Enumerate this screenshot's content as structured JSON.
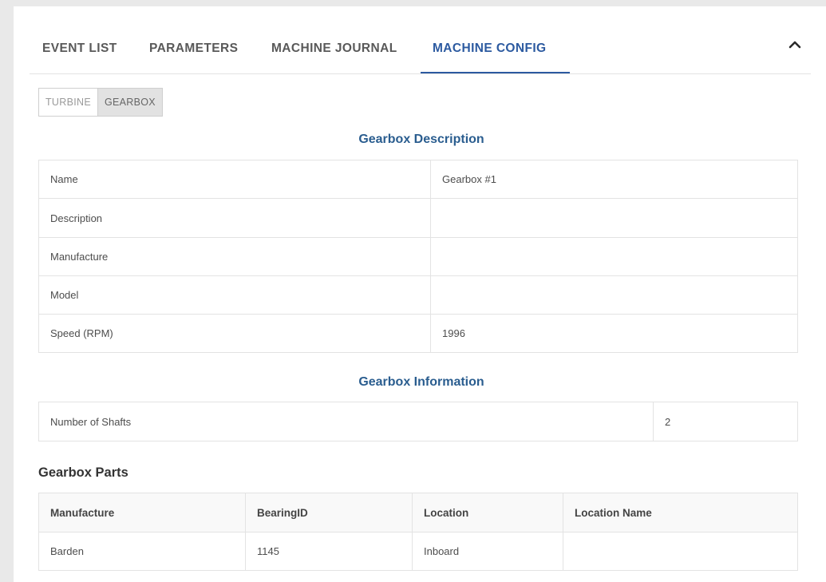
{
  "tabs": [
    {
      "label": "EVENT LIST"
    },
    {
      "label": "PARAMETERS"
    },
    {
      "label": "MACHINE JOURNAL"
    },
    {
      "label": "MACHINE CONFIG"
    }
  ],
  "active_tab": "MACHINE CONFIG",
  "subtabs": [
    {
      "label": "TURBINE"
    },
    {
      "label": "GEARBOX"
    }
  ],
  "active_subtab": "GEARBOX",
  "collapse_icon": "chevron-up-icon",
  "description": {
    "title": "Gearbox Description",
    "rows": [
      {
        "label": "Name",
        "value": "Gearbox #1"
      },
      {
        "label": "Description",
        "value": ""
      },
      {
        "label": "Manufacture",
        "value": ""
      },
      {
        "label": "Model",
        "value": ""
      },
      {
        "label": "Speed (RPM)",
        "value": "1996"
      }
    ]
  },
  "information": {
    "title": "Gearbox Information",
    "rows": [
      {
        "label": "Number of Shafts",
        "value": "2"
      }
    ]
  },
  "parts": {
    "title": "Gearbox Parts",
    "columns": [
      "Manufacture",
      "BearingID",
      "Location",
      "Location Name"
    ],
    "rows": [
      [
        "Barden",
        "1145",
        "Inboard",
        ""
      ]
    ]
  },
  "colors": {
    "accent": "#2c5aa0",
    "section_title": "#2a5d8f"
  }
}
